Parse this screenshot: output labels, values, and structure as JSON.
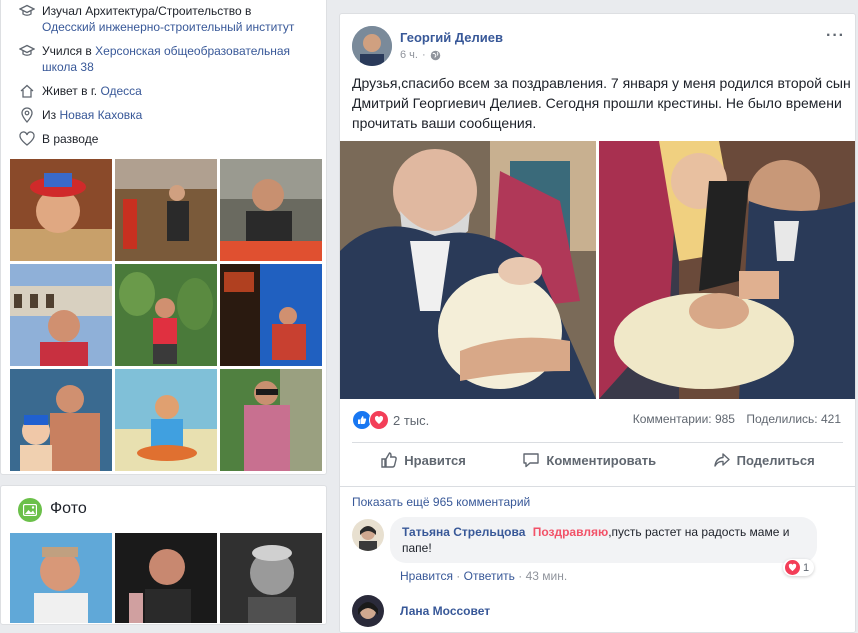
{
  "intro": {
    "items": [
      {
        "icon": "graduation-cap-icon",
        "prefix": "Изучал Архитектура/Строительство в",
        "link": "Одесский инженерно-строительный институт"
      },
      {
        "icon": "graduation-cap-icon",
        "prefix": "Учился в",
        "link": "Херсонская общеобразовательная школа 38"
      },
      {
        "icon": "home-icon",
        "prefix": "Живет в г.",
        "link": "Одесса"
      },
      {
        "icon": "location-pin-icon",
        "prefix": "Из",
        "link": "Новая Каховка"
      },
      {
        "icon": "heart-icon",
        "prefix": "В разводе",
        "link": ""
      }
    ]
  },
  "photos_section": {
    "title": "Фото"
  },
  "post": {
    "author": "Георгий Делиев",
    "time": "6 ч.",
    "separator": "·",
    "text": "Друзья,спасибо всем за поздравления. 7 января у меня родился второй сын Дмитрий Георгиевич Делиев. Сегодня прошли крестины. Не было времени прочитать ваши сообщения.",
    "reactions_count": "2 тыс.",
    "comments_count": "Комментарии: 985",
    "shares_count": "Поделились: 421",
    "actions": {
      "like": "Нравится",
      "comment": "Комментировать",
      "share": "Поделиться"
    },
    "more_comments": "Показать ещё 965 комментарий",
    "comments": [
      {
        "author": "Татьяна Стрельцова",
        "highlight": "Поздравляю",
        "text": ",пусть растет на радость маме и папе!",
        "like": "Нравится",
        "reply": "Ответить",
        "time": "43 мин.",
        "reaction_count": "1"
      },
      {
        "author": "Лана Моссовет"
      }
    ]
  },
  "colors": {
    "link": "#385898",
    "bg": "#e9ebee",
    "like_blue": "#1877f2",
    "love_red": "#f33e58",
    "highlight_red": "#f25268"
  }
}
